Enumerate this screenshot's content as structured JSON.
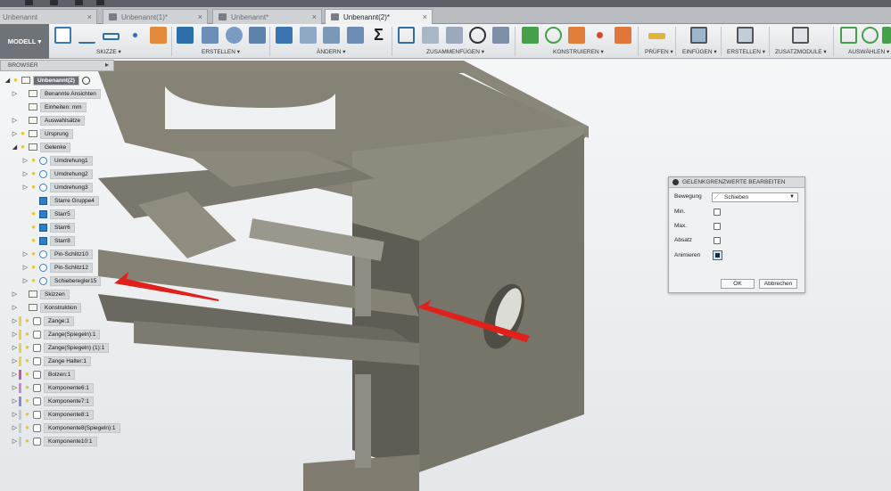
{
  "tabs": [
    {
      "label": "Unbenannt",
      "active": false
    },
    {
      "label": "Unbenannt(1)*",
      "active": false
    },
    {
      "label": "Unbenannt*",
      "active": false
    },
    {
      "label": "Unbenannt(2)*",
      "active": true
    }
  ],
  "toolbar": {
    "workspace": "MODELL",
    "groups": {
      "skizze": "SKIZZE ▾",
      "erstellen": "ERSTELLEN ▾",
      "aendern": "ÄNDERN ▾",
      "zusammenfuegen": "ZUSAMMENFÜGEN ▾",
      "konstruieren": "KONSTRUIEREN ▾",
      "pruefen": "PRÜFEN ▾",
      "einfuegen": "EINFÜGEN ▾",
      "erstellen2": "ERSTELLEN ▾",
      "zusatzmodule": "ZUSATZMODULE ▾",
      "auswaehlen": "AUSWÄHLEN ▾"
    }
  },
  "browser": {
    "title": "BROWSER",
    "root": "Unbenannt(2)",
    "items": [
      {
        "label": "Benannte Ansichten",
        "icon": "folder-icon",
        "arrow": true,
        "bulb": false
      },
      {
        "label": "Einheiten: mm",
        "icon": "units-icon",
        "arrow": false,
        "bulb": false
      },
      {
        "label": "Auswahlsätze",
        "icon": "folder-icon",
        "arrow": true,
        "bulb": false
      },
      {
        "label": "Ursprung",
        "icon": "folder-icon",
        "arrow": true,
        "bulb": true
      },
      {
        "label": "Gelenke",
        "icon": "folder-icon",
        "arrow": true,
        "bulb": true
      },
      {
        "label": "Umdrehung1",
        "icon": "revolute-joint-icon",
        "arrow": true,
        "bulb": true
      },
      {
        "label": "Umdrehung2",
        "icon": "revolute-joint-icon",
        "arrow": true,
        "bulb": true
      },
      {
        "label": "Umdrehung3",
        "icon": "revolute-joint-icon",
        "arrow": true,
        "bulb": true
      },
      {
        "label": "Starre Gruppe4",
        "icon": "rigid-group-icon",
        "arrow": false,
        "bulb": false
      },
      {
        "label": "Starr5",
        "icon": "rigid-joint-icon",
        "arrow": false,
        "bulb": true
      },
      {
        "label": "Starr6",
        "icon": "rigid-joint-icon",
        "arrow": false,
        "bulb": true
      },
      {
        "label": "Starr8",
        "icon": "rigid-joint-icon",
        "arrow": false,
        "bulb": true
      },
      {
        "label": "Pin-Schlitz10",
        "icon": "pin-slot-joint-icon",
        "arrow": true,
        "bulb": true
      },
      {
        "label": "Pin-Schlitz12",
        "icon": "pin-slot-joint-icon",
        "arrow": true,
        "bulb": true
      },
      {
        "label": "Schieberegler15",
        "icon": "slider-joint-icon",
        "arrow": true,
        "bulb": true
      },
      {
        "label": "Skizzen",
        "icon": "folder-icon",
        "arrow": true,
        "bulb": false
      },
      {
        "label": "Konstruktion",
        "icon": "folder-icon",
        "arrow": true,
        "bulb": false
      },
      {
        "label": "Zange:1",
        "icon": "component-icon",
        "arrow": true,
        "bulb": true
      },
      {
        "label": "Zange(Spiegeln):1",
        "icon": "component-icon",
        "arrow": true,
        "bulb": true
      },
      {
        "label": "Zange(Spiegeln) (1):1",
        "icon": "component-icon",
        "arrow": true,
        "bulb": true
      },
      {
        "label": "Zange Halter:1",
        "icon": "component-icon",
        "arrow": true,
        "bulb": true
      },
      {
        "label": "Bolzen:1",
        "icon": "component-icon",
        "arrow": true,
        "bulb": true
      },
      {
        "label": "Komponente6:1",
        "icon": "component-icon",
        "arrow": true,
        "bulb": true
      },
      {
        "label": "Komponente7:1",
        "icon": "component-icon",
        "arrow": true,
        "bulb": true
      },
      {
        "label": "Komponente8:1",
        "icon": "component-icon",
        "arrow": true,
        "bulb": true
      },
      {
        "label": "Komponente8(Spiegeln):1",
        "icon": "component-icon",
        "arrow": true,
        "bulb": true
      },
      {
        "label": "Komponente10:1",
        "icon": "component-icon",
        "arrow": true,
        "bulb": true
      }
    ]
  },
  "dialog": {
    "title": "GELENKGRENZWERTE BEARBEITEN",
    "bewegung_label": "Bewegung",
    "bewegung_value": "Schieben",
    "min_label": "Min.",
    "max_label": "Max.",
    "absatz_label": "Absatz",
    "animieren_label": "Animieren",
    "ok_label": "OK",
    "cancel_label": "Abbrechen"
  },
  "colors": {
    "model": "#807c70",
    "model_dark": "#5e5b52",
    "model_light": "#9b978b",
    "arrow": "#e0201a"
  }
}
